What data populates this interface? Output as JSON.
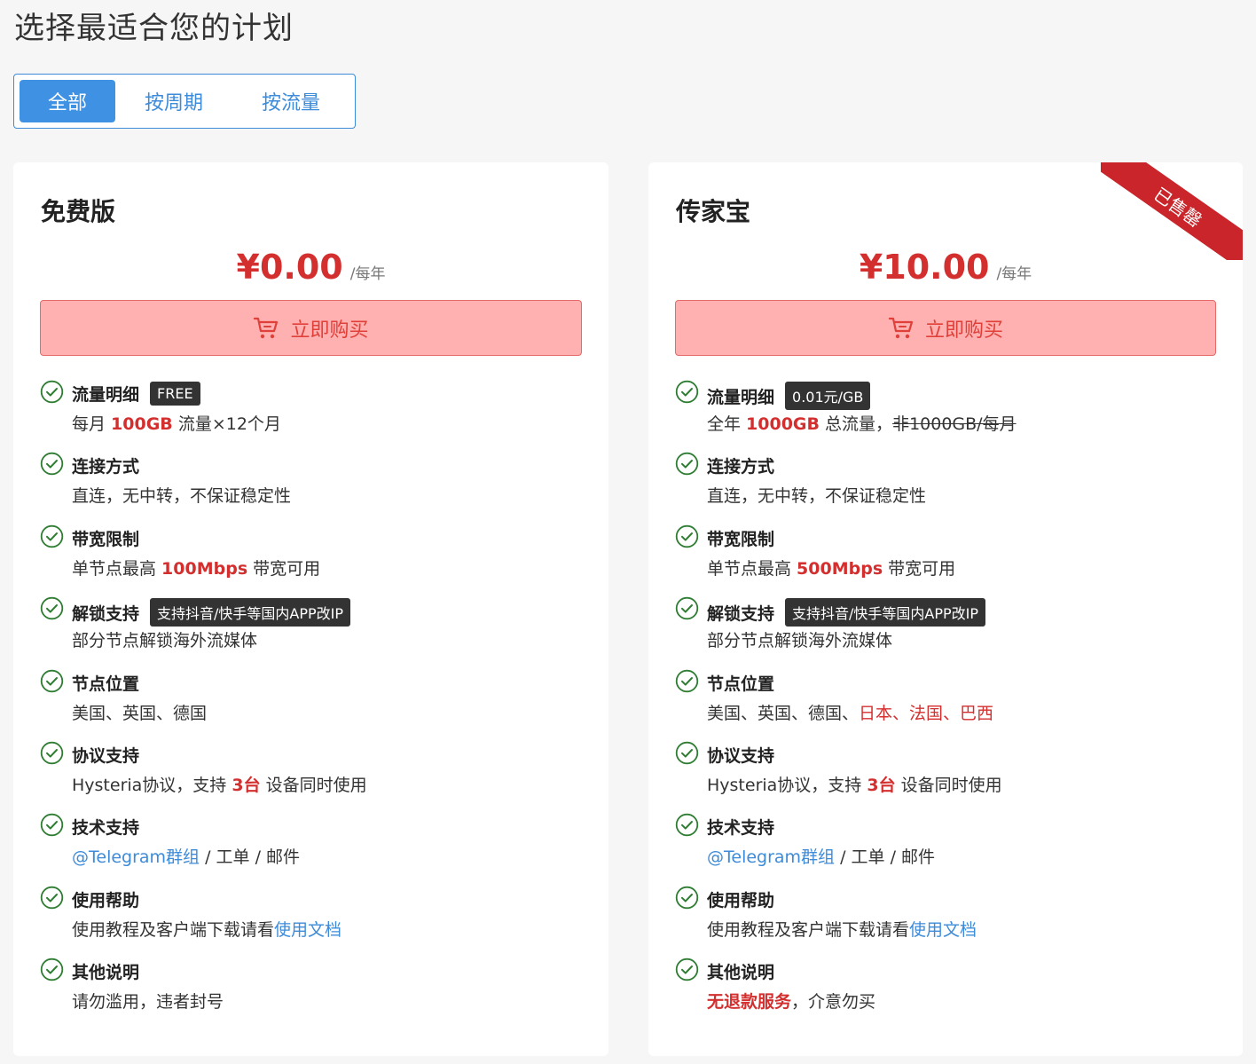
{
  "page": {
    "title": "选择最适合您的计划"
  },
  "filters": [
    "全部",
    "按周期",
    "按流量"
  ],
  "plans": [
    {
      "name": "免费版",
      "price": "¥0.00",
      "period": "/每年",
      "buy_label": "立即购买",
      "features": [
        {
          "title": "流量明细",
          "tag": "FREE",
          "desc": {
            "a": "每月 ",
            "b": "100GB",
            "c": " 流量×12个月"
          }
        },
        {
          "title": "连接方式",
          "desc": {
            "a": "直连，无中转，不保证稳定性"
          }
        },
        {
          "title": "带宽限制",
          "desc": {
            "a": "单节点最高 ",
            "b": "100Mbps",
            "c": " 带宽可用"
          }
        },
        {
          "title": "解锁支持",
          "tag": "支持抖音/快手等国内APP改IP",
          "desc": {
            "a": "部分节点解锁海外流媒体"
          }
        },
        {
          "title": "节点位置",
          "desc": {
            "a": "美国、英国、德国"
          }
        },
        {
          "title": "协议支持",
          "desc": {
            "a": "Hysteria协议，支持 ",
            "b": "3台",
            "c": " 设备同时使用"
          }
        },
        {
          "title": "技术支持",
          "desc": {
            "link": "@Telegram群组",
            "c": " / 工单 / 邮件"
          }
        },
        {
          "title": "使用帮助",
          "desc": {
            "a": "使用教程及客户端下载请看",
            "link": "使用文档"
          }
        },
        {
          "title": "其他说明",
          "desc": {
            "a": "请勿滥用，违者封号"
          }
        }
      ]
    },
    {
      "name": "传家宝",
      "price": "¥10.00",
      "period": "/每年",
      "buy_label": "立即购买",
      "ribbon": "已售罄",
      "features": [
        {
          "title": "流量明细",
          "tag": "0.01元/GB",
          "desc": {
            "a": "全年 ",
            "b": "1000GB",
            "c": " 总流量，",
            "strike": "非1000GB/每月"
          }
        },
        {
          "title": "连接方式",
          "desc": {
            "a": "直连，无中转，不保证稳定性"
          }
        },
        {
          "title": "带宽限制",
          "desc": {
            "a": "单节点最高 ",
            "b": "500Mbps",
            "c": " 带宽可用"
          }
        },
        {
          "title": "解锁支持",
          "tag": "支持抖音/快手等国内APP改IP",
          "desc": {
            "a": "部分节点解锁海外流媒体"
          }
        },
        {
          "title": "节点位置",
          "desc": {
            "a": "美国、英国、德国、",
            "red": "日本、法国、巴西"
          }
        },
        {
          "title": "协议支持",
          "desc": {
            "a": "Hysteria协议，支持 ",
            "b": "3台",
            "c": " 设备同时使用"
          }
        },
        {
          "title": "技术支持",
          "desc": {
            "link": "@Telegram群组",
            "c": " / 工单 / 邮件"
          }
        },
        {
          "title": "使用帮助",
          "desc": {
            "a": "使用教程及客户端下载请看",
            "link": "使用文档"
          }
        },
        {
          "title": "其他说明",
          "desc": {
            "redb": "无退款服务",
            "c": "，介意勿买"
          }
        }
      ]
    }
  ],
  "colors": {
    "accent": "#3e91e3",
    "price": "#d32f2f",
    "check": "#2e7d32",
    "ribbon": "#c9252a"
  }
}
